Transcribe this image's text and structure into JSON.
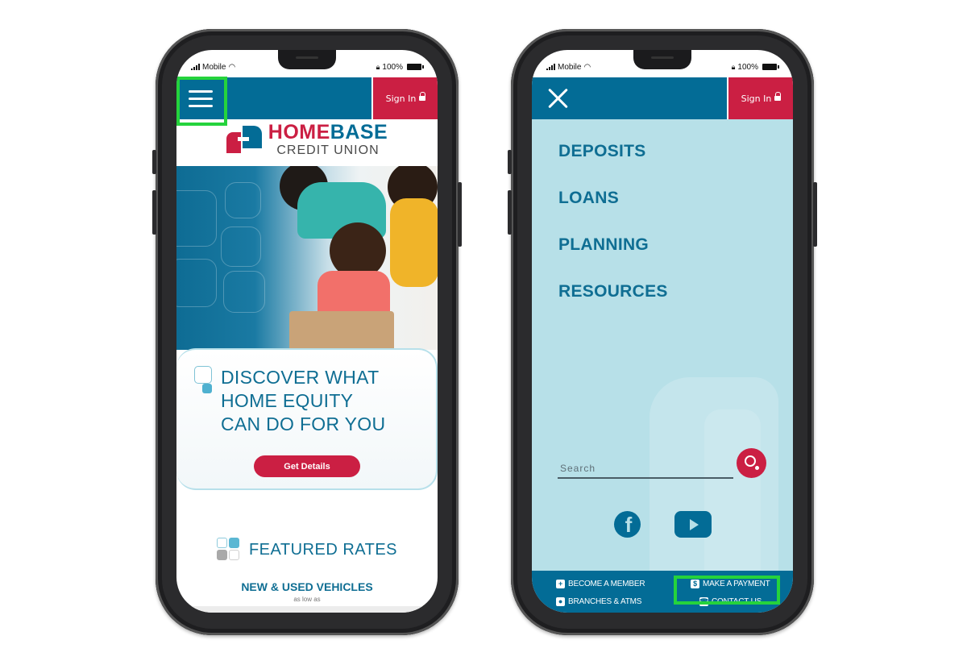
{
  "status_bar": {
    "carrier": "Mobile",
    "battery": "100%"
  },
  "left_phone": {
    "sign_in_label": "Sign In",
    "logo": {
      "brand_part1": "HOME",
      "brand_part2": "BASE",
      "subtitle": "CREDIT UNION"
    },
    "hero": {
      "title_lines": [
        "DISCOVER WHAT",
        "HOME EQUITY",
        "CAN DO FOR YOU"
      ],
      "cta_label": "Get Details"
    },
    "featured_rates": {
      "title": "FEATURED RATES",
      "category": "NEW & USED VEHICLES",
      "rate_prefix": "as low as"
    }
  },
  "right_phone": {
    "sign_in_label": "Sign In",
    "menu_items": [
      "DEPOSITS",
      "LOANS",
      "PLANNING",
      "RESOURCES"
    ],
    "search": {
      "placeholder": "Search",
      "value": ""
    },
    "social": [
      "facebook",
      "youtube"
    ],
    "footer_links": [
      {
        "label": "BECOME A MEMBER",
        "icon": "plus-icon"
      },
      {
        "label": "MAKE A PAYMENT",
        "icon": "dollar-icon"
      },
      {
        "label": "BRANCHES & ATMS",
        "icon": "location-icon"
      },
      {
        "label": "CONTACT US",
        "icon": "phone-icon"
      }
    ]
  },
  "colors": {
    "brand_blue": "#036c96",
    "brand_red": "#cb1f43",
    "menu_bg": "#b7e0e8",
    "highlight": "#25d33c"
  }
}
